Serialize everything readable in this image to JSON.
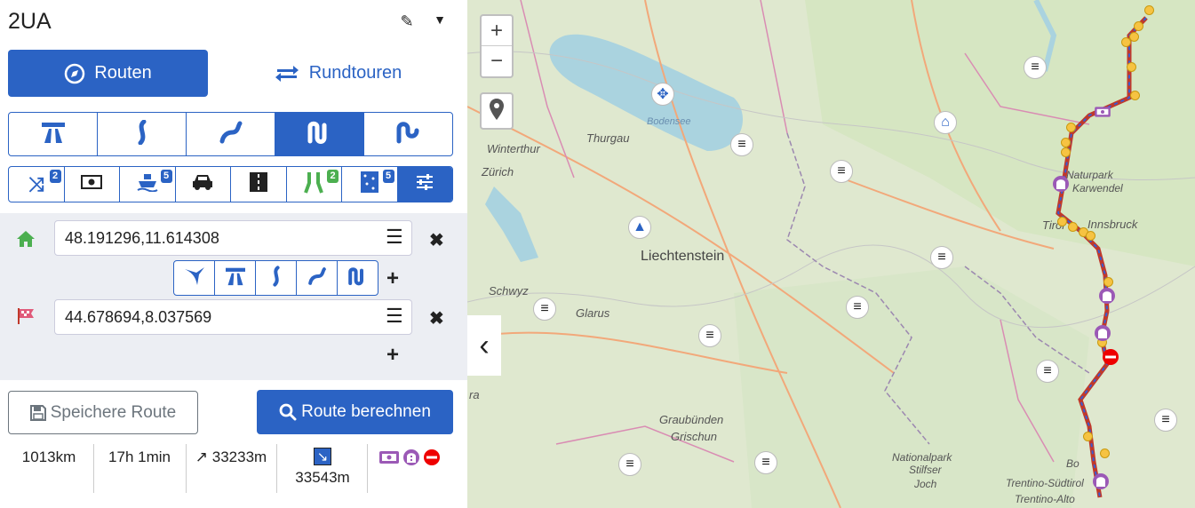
{
  "header": {
    "title": "2UA"
  },
  "mode_tabs": {
    "routes": "Routen",
    "roundtrips": "Rundtouren"
  },
  "option_badges": {
    "random": "2",
    "ferry": "5",
    "narrow": "2",
    "offroad": "5"
  },
  "waypoints": [
    {
      "value": "48.191296,11.614308"
    },
    {
      "value": "44.678694,8.037569"
    }
  ],
  "actions": {
    "save": "Speichere Route",
    "calculate": "Route berechnen"
  },
  "stats": {
    "distance": "1013km",
    "duration": "17h 1min",
    "ascent": "↗ 33233m",
    "descent": "33543m"
  },
  "map": {
    "labels": [
      "Winterthur",
      "Zürich",
      "Thurgau",
      "Bodensee",
      "Liechtenstein",
      "Schwyz",
      "Glarus",
      "Graubünden",
      "Grischun",
      "Nationalpark",
      "Stilfser",
      "Joch",
      "Naturpark",
      "Karwendel",
      "Tirol",
      "Innsbruck",
      "Trentino-Südtirol",
      "Trentino-Alto",
      "Bo",
      "ra"
    ],
    "zoom_in": "+",
    "zoom_out": "−",
    "collapse": "‹"
  },
  "colors": {
    "primary": "#2b63c4",
    "route": "#c0392b",
    "poi": "#f6c342"
  }
}
